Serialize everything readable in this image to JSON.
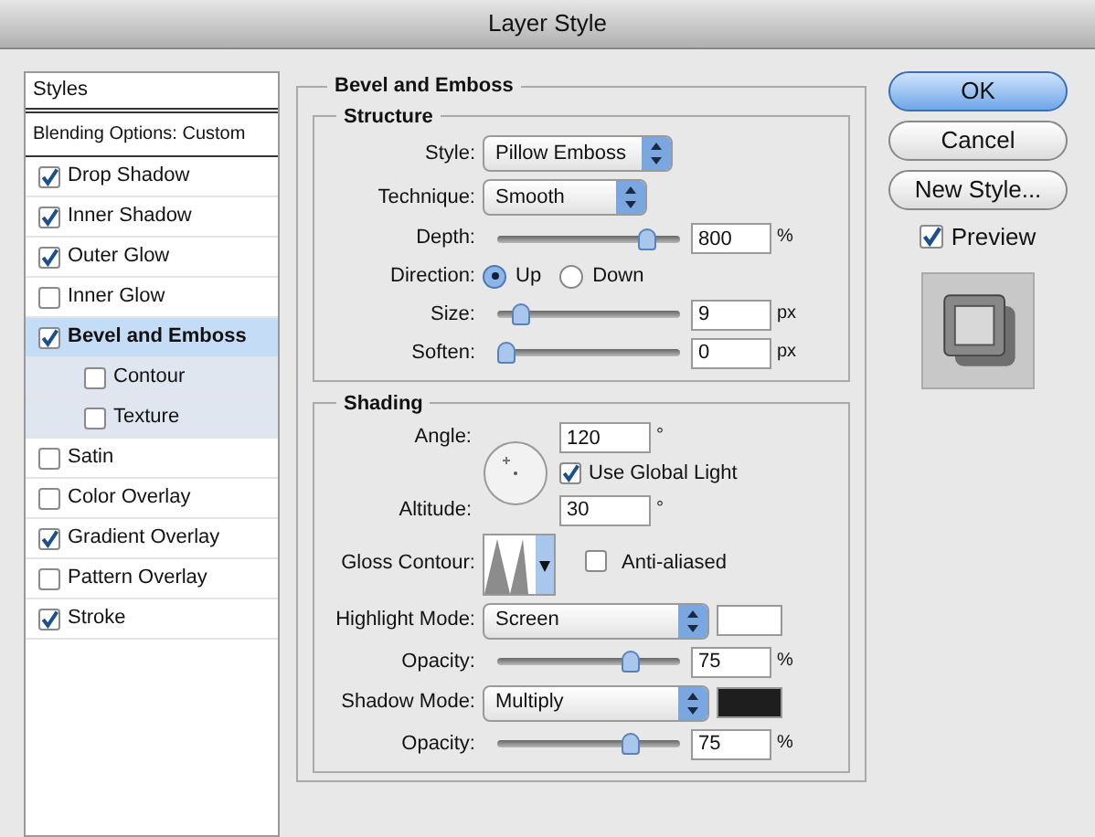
{
  "window": {
    "title": "Layer Style"
  },
  "styles_list": {
    "header": "Styles",
    "blending": "Blending Options: Custom",
    "items": [
      {
        "label": "Drop Shadow",
        "checked": true,
        "selected": false
      },
      {
        "label": "Inner Shadow",
        "checked": true,
        "selected": false
      },
      {
        "label": "Outer Glow",
        "checked": true,
        "selected": false
      },
      {
        "label": "Inner Glow",
        "checked": false,
        "selected": false
      },
      {
        "label": "Bevel and Emboss",
        "checked": true,
        "selected": true,
        "children": [
          {
            "label": "Contour",
            "checked": false,
            "selected": false
          },
          {
            "label": "Texture",
            "checked": false,
            "selected": false
          }
        ]
      },
      {
        "label": "Satin",
        "checked": false,
        "selected": false
      },
      {
        "label": "Color Overlay",
        "checked": false,
        "selected": false
      },
      {
        "label": "Gradient Overlay",
        "checked": true,
        "selected": false
      },
      {
        "label": "Pattern Overlay",
        "checked": false,
        "selected": false
      },
      {
        "label": "Stroke",
        "checked": true,
        "selected": false
      }
    ]
  },
  "panel": {
    "title": "Bevel and Emboss",
    "structure": {
      "title": "Structure",
      "rows": [
        {
          "kind": "select",
          "label": "Style:",
          "value": "Pillow Emboss"
        },
        {
          "kind": "select",
          "label": "Technique:",
          "value": "Smooth"
        },
        {
          "kind": "slider",
          "label": "Depth:",
          "level": 0.85,
          "value": "800",
          "unit": "%"
        },
        {
          "kind": "radio",
          "label": "Direction:",
          "options": [
            {
              "label": "Up",
              "selected": true
            },
            {
              "label": "Down",
              "selected": false
            }
          ]
        },
        {
          "kind": "slider",
          "label": "Size:",
          "level": 0.09,
          "value": "9",
          "unit": "px"
        },
        {
          "kind": "slider",
          "label": "Soften:",
          "level": 0,
          "value": "0",
          "unit": "px"
        }
      ]
    },
    "shading": {
      "title": "Shading",
      "angle": {
        "label": "Angle:",
        "value": "120",
        "unit": "°"
      },
      "global_light": {
        "label": "Use Global Light",
        "checked": true
      },
      "altitude": {
        "label": "Altitude:",
        "value": "30",
        "unit": "°"
      },
      "gloss_contour": {
        "label": "Gloss Contour:"
      },
      "anti_aliased": {
        "label": "Anti-aliased",
        "checked": false
      },
      "rows": [
        {
          "kind": "mode",
          "label": "Highlight Mode:",
          "value": "Screen",
          "color": "#ffffff"
        },
        {
          "kind": "slider",
          "label": "Opacity:",
          "level": 0.75,
          "value": "75",
          "unit": "%"
        },
        {
          "kind": "mode",
          "label": "Shadow Mode:",
          "value": "Multiply",
          "color": "#1e1e1e"
        },
        {
          "kind": "slider",
          "label": "Opacity:",
          "level": 0.75,
          "value": "75",
          "unit": "%"
        }
      ]
    }
  },
  "buttons": [
    {
      "label": "OK",
      "default": true
    },
    {
      "label": "Cancel",
      "default": false
    },
    {
      "label": "New Style...",
      "default": false
    }
  ],
  "preview": {
    "label": "Preview",
    "checked": true
  }
}
